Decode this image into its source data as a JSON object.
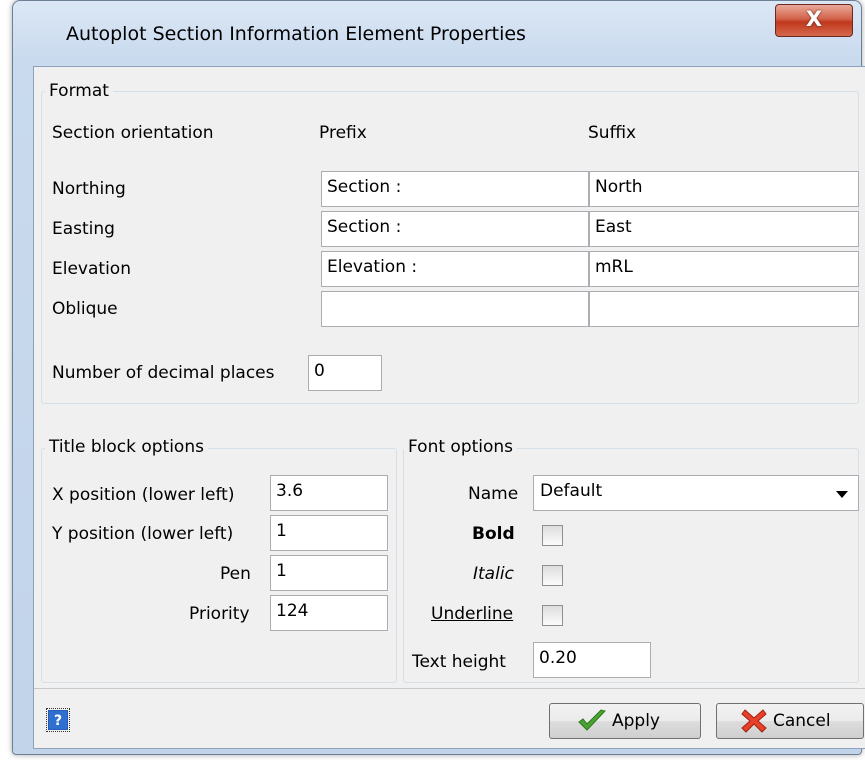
{
  "window": {
    "title": "Autoplot Section Information Element Properties",
    "close_label": "X"
  },
  "format": {
    "group_label": "Format",
    "col_orientation": "Section orientation",
    "col_prefix": "Prefix",
    "col_suffix": "Suffix",
    "rows": [
      {
        "label": "Northing",
        "prefix": "Section :",
        "suffix": "North"
      },
      {
        "label": "Easting",
        "prefix": "Section :",
        "suffix": "East"
      },
      {
        "label": "Elevation",
        "prefix": "Elevation :",
        "suffix": "mRL"
      },
      {
        "label": "Oblique",
        "prefix": "",
        "suffix": ""
      }
    ],
    "decimals_label": "Number of decimal places",
    "decimals_value": "0"
  },
  "title_block": {
    "group_label": "Title block options",
    "x_label": "X position (lower left)",
    "x_value": "3.6",
    "y_label": "Y position (lower left)",
    "y_value": "1",
    "pen_label": "Pen",
    "pen_value": "1",
    "priority_label": "Priority",
    "priority_value": "124"
  },
  "font": {
    "group_label": "Font options",
    "name_label": "Name",
    "name_value": "Default",
    "bold_label": "Bold",
    "bold_checked": false,
    "italic_label": "Italic",
    "italic_checked": false,
    "underline_label": "Underline",
    "underline_checked": false,
    "height_label": "Text height",
    "height_value": "0.20"
  },
  "footer": {
    "help_icon": "question-help-icon",
    "apply_label": "Apply",
    "cancel_label": "Cancel",
    "apply_icon": "green-checkmark-icon",
    "cancel_icon": "red-x-icon"
  }
}
